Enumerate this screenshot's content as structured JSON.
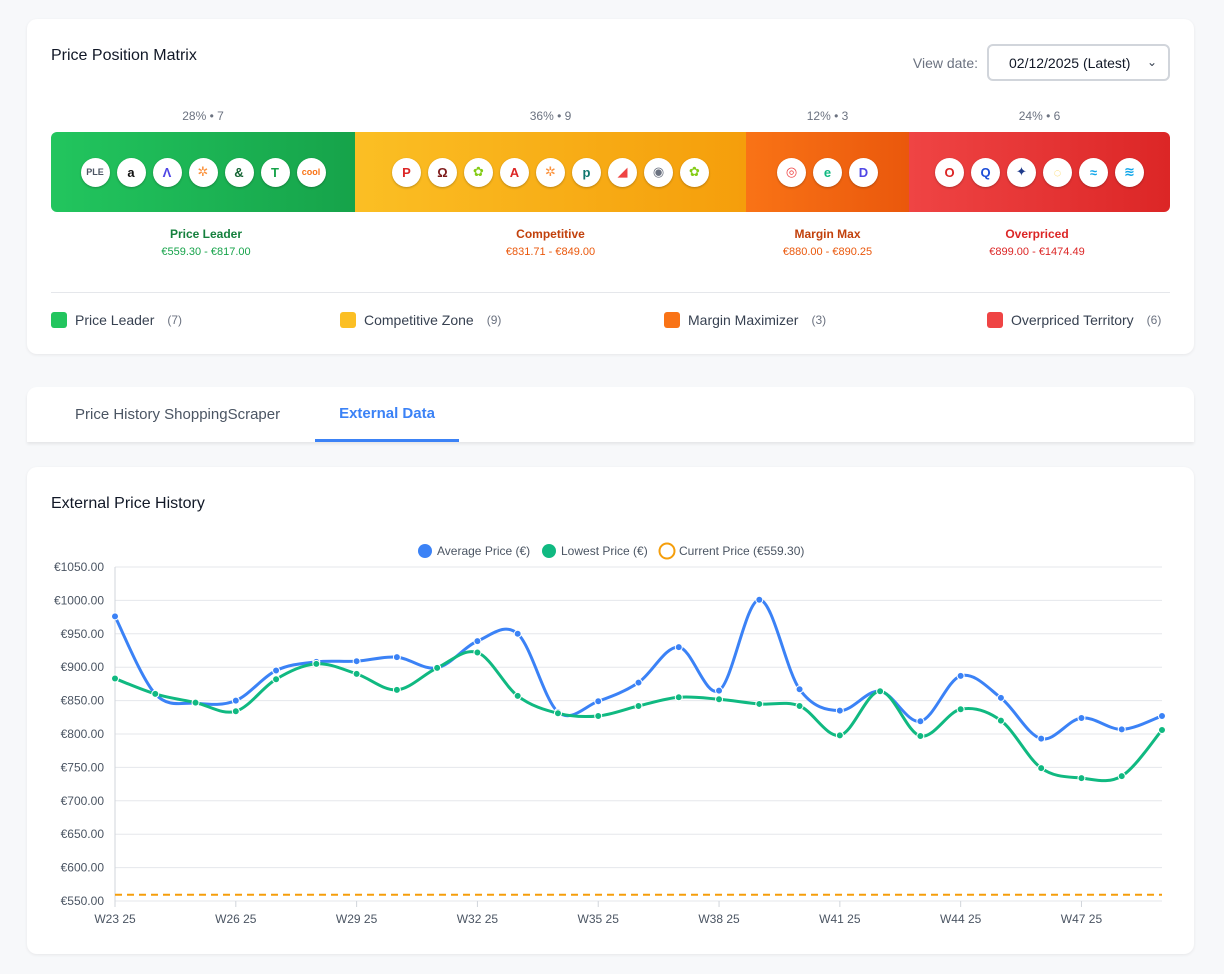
{
  "matrix": {
    "title": "Price Position Matrix",
    "view_date_label": "View date:",
    "view_date_value": "02/12/2025 (Latest)",
    "segments": [
      {
        "key": "leader",
        "top": "28% • 7",
        "label": "Price Leader",
        "range": "€559.30 - €817.00",
        "label_color": "#15803d",
        "range_color": "#16a34a",
        "logos": [
          {
            "t": "PLE",
            "c": "#4b5563"
          },
          {
            "t": "a",
            "c": "#111111"
          },
          {
            "t": "Λ",
            "c": "#4f46e5"
          },
          {
            "t": "✲",
            "c": "#fb923c"
          },
          {
            "t": "&",
            "c": "#166534"
          },
          {
            "t": "T",
            "c": "#16a34a"
          },
          {
            "t": "cool",
            "c": "#f97316"
          }
        ]
      },
      {
        "key": "competitive",
        "top": "36% • 9",
        "label": "Competitive",
        "range": "€831.71 - €849.00",
        "label_color": "#c2410c",
        "range_color": "#ea580c",
        "logos": [
          {
            "t": "P",
            "c": "#dc2626"
          },
          {
            "t": "Ω",
            "c": "#7f1d1d"
          },
          {
            "t": "✿",
            "c": "#84cc16"
          },
          {
            "t": "A",
            "c": "#dc2626"
          },
          {
            "t": "✲",
            "c": "#fb923c"
          },
          {
            "t": "p",
            "c": "#0f766e"
          },
          {
            "t": "◢",
            "c": "#ef4444"
          },
          {
            "t": "◉",
            "c": "#6b7280"
          },
          {
            "t": "✿",
            "c": "#84cc16"
          }
        ]
      },
      {
        "key": "margin",
        "top": "12% • 3",
        "label": "Margin Max",
        "range": "€880.00 - €890.25",
        "label_color": "#c2410c",
        "range_color": "#ea580c",
        "logos": [
          {
            "t": "◎",
            "c": "#ef4444"
          },
          {
            "t": "e",
            "c": "#10b981"
          },
          {
            "t": "D",
            "c": "#4f46e5"
          }
        ]
      },
      {
        "key": "over",
        "top": "24% • 6",
        "label": "Overpriced",
        "range": "€899.00 - €1474.49",
        "label_color": "#dc2626",
        "range_color": "#dc2626",
        "logos": [
          {
            "t": "O",
            "c": "#dc2626"
          },
          {
            "t": "Q",
            "c": "#1d4ed8"
          },
          {
            "t": "✦",
            "c": "#1e3a8a"
          },
          {
            "t": "◌",
            "c": "#fcd34d"
          },
          {
            "t": "≈",
            "c": "#0ea5e9"
          },
          {
            "t": "≋",
            "c": "#0ea5e9"
          }
        ]
      }
    ],
    "legend": [
      {
        "label": "Price Leader",
        "count": "(7)",
        "color": "#22c55e"
      },
      {
        "label": "Competitive Zone",
        "count": "(9)",
        "color": "#fbbf24"
      },
      {
        "label": "Margin Maximizer",
        "count": "(3)",
        "color": "#f97316"
      },
      {
        "label": "Overpriced Territory",
        "count": "(6)",
        "color": "#ef4444"
      }
    ]
  },
  "tabs": [
    {
      "label": "Price History ShoppingScraper",
      "active": false
    },
    {
      "label": "External Data",
      "active": true
    }
  ],
  "chart_card": {
    "title": "External Price History"
  },
  "chart_data": {
    "type": "line",
    "title": "External Price History",
    "x": [
      "W23 25",
      "W24 25",
      "W25 25",
      "W26 25",
      "W27 25",
      "W28 25",
      "W29 25",
      "W30 25",
      "W31 25",
      "W32 25",
      "W33 25",
      "W34 25",
      "W35 25",
      "W36 25",
      "W37 25",
      "W38 25",
      "W39 25",
      "W40 25",
      "W41 25",
      "W42 25",
      "W43 25",
      "W44 25",
      "W45 25",
      "W46 25",
      "W47 25",
      "W48 25",
      "W49 25"
    ],
    "x_tick_labels": [
      "W23 25",
      "W26 25",
      "W29 25",
      "W32 25",
      "W35 25",
      "W38 25",
      "W41 25",
      "W44 25",
      "W47 25"
    ],
    "ylim": [
      550,
      1050
    ],
    "y_ticks": [
      "€1050.00",
      "€1000.00",
      "€950.00",
      "€900.00",
      "€850.00",
      "€800.00",
      "€750.00",
      "€700.00",
      "€650.00",
      "€600.00",
      "€550.00"
    ],
    "series": [
      {
        "name": "Average Price (€)",
        "color": "#3b82f6",
        "values": [
          976,
          860,
          846,
          850,
          895,
          908,
          909,
          915,
          899,
          939,
          950,
          833,
          849,
          877,
          930,
          865,
          1001,
          867,
          835,
          864,
          819,
          887,
          854,
          793,
          824,
          807,
          827
        ]
      },
      {
        "name": "Lowest Price (€)",
        "color": "#10b981",
        "values": [
          883,
          860,
          847,
          834,
          882,
          905,
          890,
          866,
          899,
          922,
          857,
          831,
          827,
          842,
          855,
          852,
          845,
          842,
          798,
          864,
          797,
          837,
          820,
          749,
          734,
          737,
          806
        ]
      },
      {
        "name": "Current Price (€559.30)",
        "color": "#f59e0b",
        "value": 559.3,
        "style": "dashed"
      }
    ],
    "legend": "top-center",
    "grid": true
  }
}
